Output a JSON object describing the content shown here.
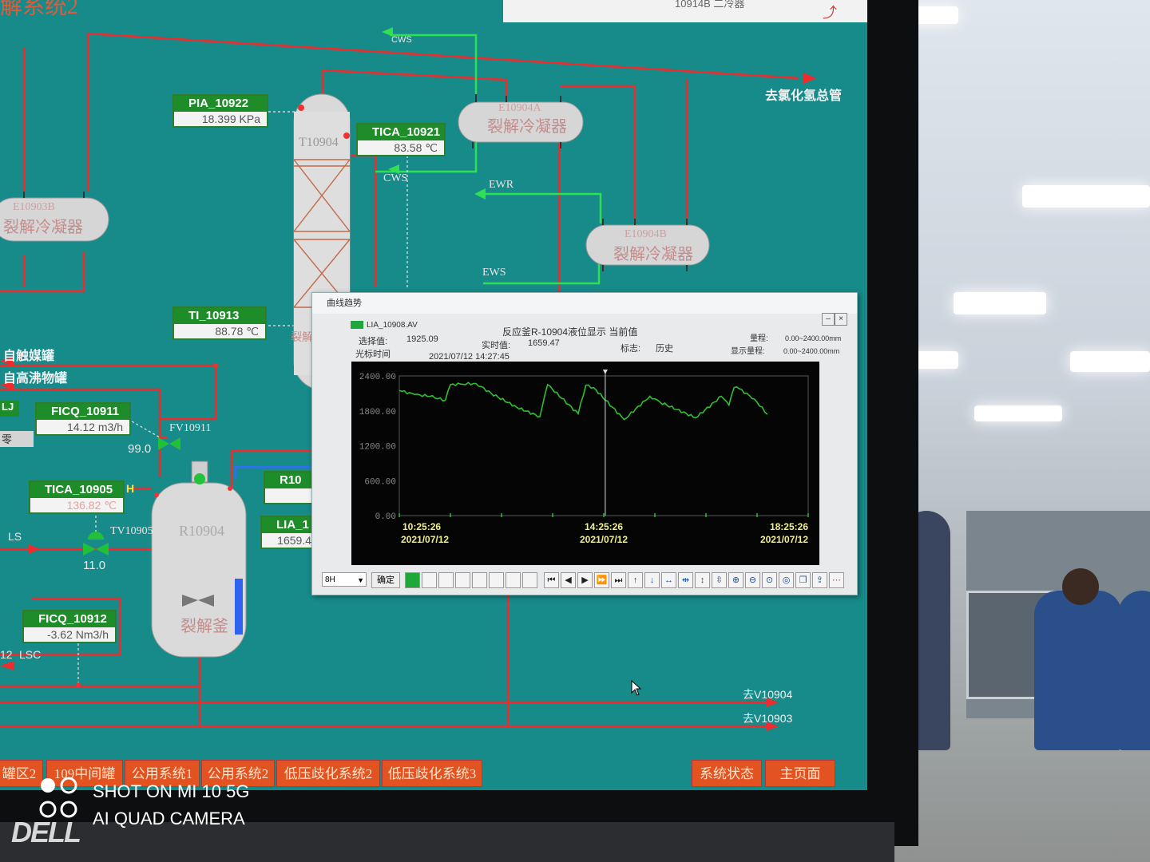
{
  "screen": {
    "header_title_fragment": "解系统2",
    "header_tab_fragment": "10914B 二冷器",
    "tags": [
      {
        "id": "pia",
        "tag": "PIA_10922",
        "value": "18.399 KPa"
      },
      {
        "id": "tica21",
        "tag": "TICA_10921",
        "value": "83.58 ℃"
      },
      {
        "id": "ti13",
        "tag": "TI_10913",
        "value": "88.78 ℃"
      },
      {
        "id": "ficq11",
        "tag": "FICQ_10911",
        "value": "14.12 m3/h"
      },
      {
        "id": "tica05",
        "tag": "TICA_10905",
        "value": "136.82 ℃"
      },
      {
        "id": "ficq12",
        "tag": "FICQ_10912",
        "value": "-3.62 Nm3/h"
      },
      {
        "id": "r10",
        "tag": "R10",
        "value": ""
      },
      {
        "id": "lia",
        "tag": "LIA_1",
        "value": "1659.4"
      }
    ],
    "labels": {
      "cws_top": "CWS",
      "cws_mid": "CWS",
      "ewr": "EWR",
      "ews": "EWS",
      "to_hcl": "去氯化氢总管",
      "from_catalyst": "自触媒罐",
      "from_highboil": "自高沸物罐",
      "lj": "LJ",
      "zero": "零",
      "fv": "FV10911",
      "fv_value": "99.0",
      "tv": "TV10905",
      "tv_value": "11.0",
      "ls": "LS",
      "lsc": "LSC",
      "lsc_num": "12",
      "h_flag": "H",
      "to_v10904": "去V10904",
      "to_v10903": "去V10903"
    },
    "vessels": {
      "column": "T10904",
      "column_sub": "裂解□",
      "e10903b_id": "E10903B",
      "e10903b_name": "裂解冷凝器",
      "e10904a_id": "E10904A",
      "e10904a_name": "裂解冷凝器",
      "e10904b_id": "E10904B",
      "e10904b_name": "裂解冷凝器",
      "reactor_id": "R10904",
      "reactor_name": "裂解釜"
    },
    "nav": [
      {
        "label": "罐区2"
      },
      {
        "label": "109中间罐"
      },
      {
        "label": "公用系统1"
      },
      {
        "label": "公用系统2"
      },
      {
        "label": "低压歧化系统2"
      },
      {
        "label": "低压歧化系统3"
      },
      {
        "label": "系统状态"
      },
      {
        "label": "主页面"
      }
    ]
  },
  "trend_window": {
    "outer_title": "曲线趋势",
    "series_tag": "LIA_10908.AV",
    "description": "反应釜R-10904液位显示 当前值",
    "selected_label": "选择值:",
    "selected_value": "1925.09",
    "realtime_label": "实时值:",
    "realtime_value": "1659.47",
    "cursor_label": "光标时间",
    "cursor_time": "2021/07/12 14:27:45",
    "flag_label": "标志:",
    "flag_value": "历史",
    "range_label": "量程:",
    "range_value": "0.00~2400.00mm",
    "display_range_label": "显示量程:",
    "display_range_value": "0.00~2400.00mm",
    "period_select": "8H",
    "confirm_label": "确定",
    "accent_color": "#2fbf2f"
  },
  "chart_data": {
    "type": "line",
    "title": "",
    "xlabel": "",
    "ylabel": "",
    "ylim": [
      0,
      2400
    ],
    "yticks": [
      "2400.00",
      "1800.00",
      "1200.00",
      "600.00",
      "0.00"
    ],
    "xtick_labels": [
      {
        "time": "10:25:26",
        "date": "2021/07/12"
      },
      {
        "time": "14:25:26",
        "date": "2021/07/12"
      },
      {
        "time": "18:25:26",
        "date": "2021/07/12"
      }
    ],
    "x_hours": [
      0.0,
      0.3,
      0.6,
      0.9,
      1.0,
      1.2,
      1.5,
      1.8,
      2.3,
      2.75,
      2.9,
      3.5,
      3.65,
      3.8,
      4.4,
      4.9,
      5.1,
      5.8,
      6.3,
      6.45,
      6.55,
      6.65,
      6.95,
      7.2
    ],
    "series": [
      {
        "values": [
          2150,
          2080,
          2050,
          1980,
          2250,
          2260,
          2270,
          2100,
          1860,
          1700,
          2250,
          1750,
          2240,
          2200,
          1650,
          2050,
          1950,
          1680,
          2050,
          1900,
          2200,
          2180,
          2000,
          1740
        ]
      }
    ],
    "cursor_hours": 4.03,
    "grid": false,
    "line_color": "#2fbf2f"
  },
  "watermark": {
    "line1": "SHOT ON MI 10 5G",
    "line2": "AI QUAD CAMERA",
    "brand": "DELL"
  }
}
